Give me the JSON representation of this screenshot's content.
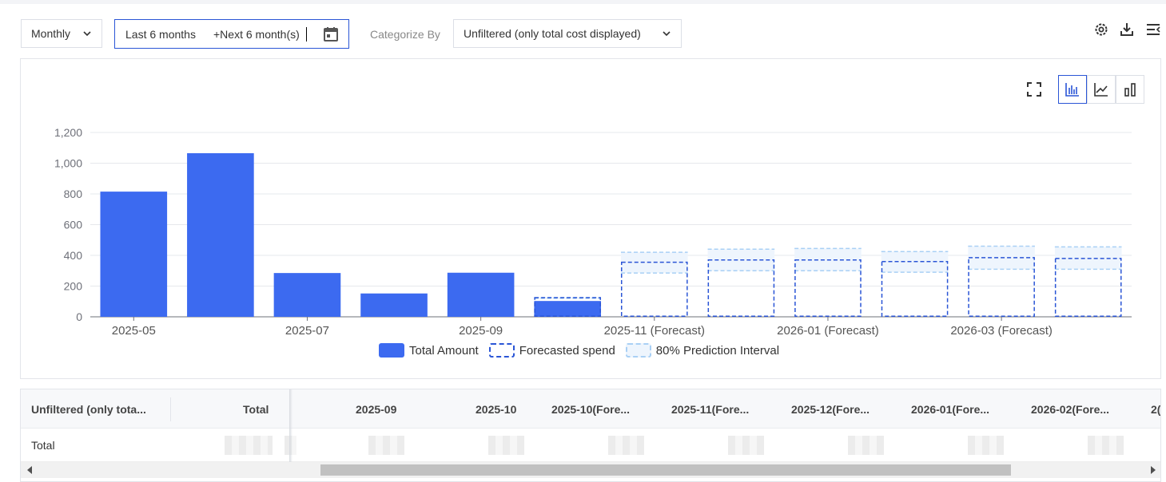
{
  "toolbar": {
    "granularity": "Monthly",
    "date_range_part1": "Last 6 months",
    "date_range_part2": "+Next 6 month(s)",
    "categorize_label": "Categorize By",
    "categorize_value": "Unfiltered (only total cost displayed)",
    "icons": [
      "settings-icon",
      "download-icon",
      "collapse-menu-icon"
    ]
  },
  "chart_tools": [
    "fullscreen-icon",
    "bar-chart-icon",
    "line-chart-icon",
    "column-chart-icon"
  ],
  "chart_data": {
    "type": "bar",
    "categories": [
      "2025-05",
      "2025-06",
      "2025-07",
      "2025-08",
      "2025-09",
      "2025-10",
      "2025-11",
      "2025-12",
      "2026-01",
      "2026-02",
      "2026-03",
      "2026-04"
    ],
    "x_tick_labels": [
      "2025-05",
      "2025-07",
      "2025-09",
      "2025-11 (Forecast)",
      "2026-01 (Forecast)",
      "2026-03 (Forecast)"
    ],
    "series": [
      {
        "name": "Total Amount",
        "values": [
          815,
          1065,
          285,
          152,
          287,
          103,
          null,
          null,
          null,
          null,
          null,
          null
        ]
      },
      {
        "name": "Forecasted spend",
        "values": [
          null,
          null,
          null,
          null,
          null,
          125,
          355,
          370,
          370,
          360,
          385,
          380
        ]
      },
      {
        "name": "80% Prediction Interval",
        "lower": [
          null,
          null,
          null,
          null,
          null,
          120,
          285,
          300,
          300,
          290,
          310,
          310
        ],
        "upper": [
          null,
          null,
          null,
          null,
          null,
          125,
          420,
          440,
          445,
          425,
          460,
          455
        ]
      }
    ],
    "ylim": [
      0,
      1200
    ],
    "yticks": [
      "0",
      "200",
      "400",
      "600",
      "800",
      "1,000",
      "1,200"
    ],
    "grid": true,
    "legend_position": "bottom-center",
    "colors": {
      "total": "#3c6af0",
      "forecast": "#2a55d6",
      "interval": "#a9d0f5"
    }
  },
  "legend": {
    "total": "Total Amount",
    "forecast": "Forecasted spend",
    "interval": "80% Prediction Interval"
  },
  "table": {
    "headers": [
      "Unfiltered (only tota...",
      "Total",
      "2025-09",
      "2025-10",
      "2025-10(Fore...",
      "2025-11(Fore...",
      "2025-12(Fore...",
      "2026-01(Fore...",
      "2026-02(Fore...",
      "2("
    ],
    "row_label": "Total"
  }
}
